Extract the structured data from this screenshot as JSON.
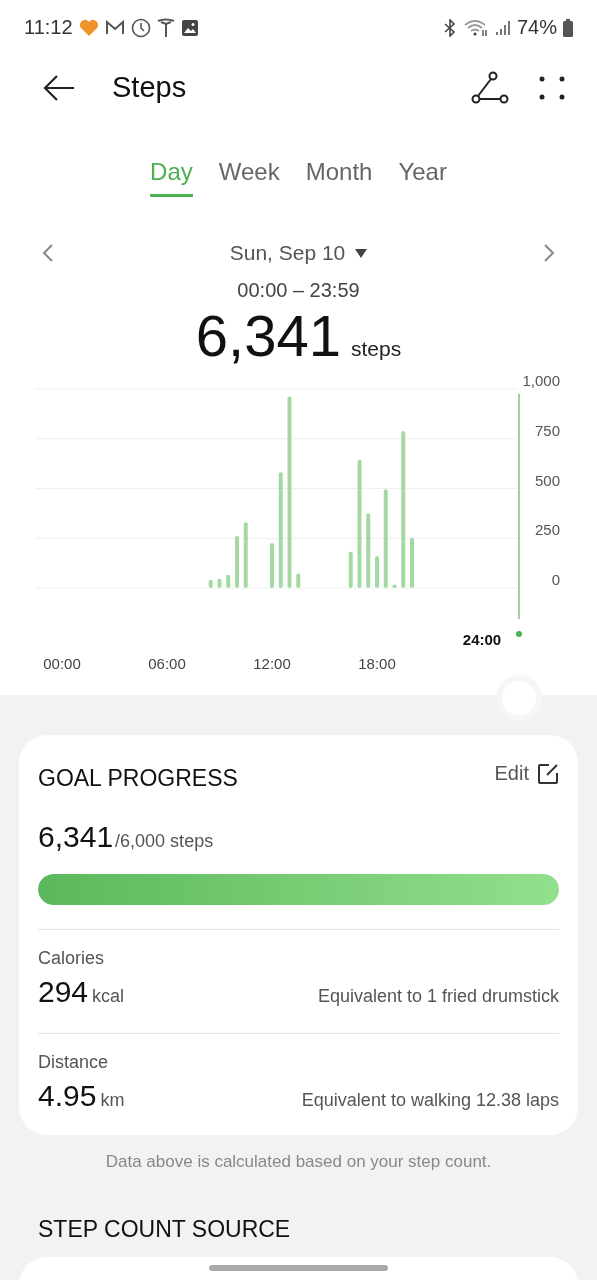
{
  "status_bar": {
    "time": "11:12",
    "battery": "74%"
  },
  "header": {
    "title": "Steps"
  },
  "tabs": [
    {
      "label": "Day",
      "selected": true
    },
    {
      "label": "Week",
      "selected": false
    },
    {
      "label": "Month",
      "selected": false
    },
    {
      "label": "Year",
      "selected": false
    }
  ],
  "date_nav": {
    "date": "Sun, Sep 10",
    "range": "00:00 – 23:59"
  },
  "total": {
    "value": "6,341",
    "unit": "steps"
  },
  "chart_data": {
    "type": "bar",
    "x": [
      8.5,
      9,
      9.5,
      10,
      10.5,
      12,
      12.5,
      13,
      13.5,
      16.5,
      17,
      17.5,
      18,
      18.5,
      19,
      19.5,
      20
    ],
    "series": [
      {
        "color": "#a3d9a0",
        "values": [
          42,
          46,
          67,
          261,
          330,
          226,
          582,
          962,
          73,
          182,
          644,
          376,
          161,
          496,
          17,
          789,
          253
        ]
      }
    ],
    "xlim": [
      -1.5,
      26
    ],
    "ylim": [
      0,
      1000
    ],
    "grid": true,
    "xticks": [
      {
        "value": 0,
        "label": "00:00"
      },
      {
        "value": 6,
        "label": "06:00"
      },
      {
        "value": 12,
        "label": "12:00"
      },
      {
        "value": 18,
        "label": "18:00"
      }
    ],
    "yticks": [
      {
        "value": 0,
        "label": "0"
      },
      {
        "value": 250,
        "label": "250"
      },
      {
        "value": 500,
        "label": "500"
      },
      {
        "value": 750,
        "label": "750"
      },
      {
        "value": 1000,
        "label": "1,000"
      }
    ]
  },
  "scrubber": {
    "time": "24:00"
  },
  "goal": {
    "title": "GOAL PROGRESS",
    "edit": "Edit",
    "value": "6,341",
    "target": "/6,000 steps",
    "level": 1,
    "rows": [
      {
        "label": "Calories",
        "value": "294",
        "unit": "kcal",
        "note": "Equivalent to 1 fried drumstick"
      },
      {
        "label": "Distance",
        "value": "4.95",
        "unit": "km",
        "note": "Equivalent to walking 12.38 laps"
      }
    ]
  },
  "footnote": "Data above is calculated based on your step count.",
  "source": {
    "title": "STEP COUNT SOURCE"
  }
}
